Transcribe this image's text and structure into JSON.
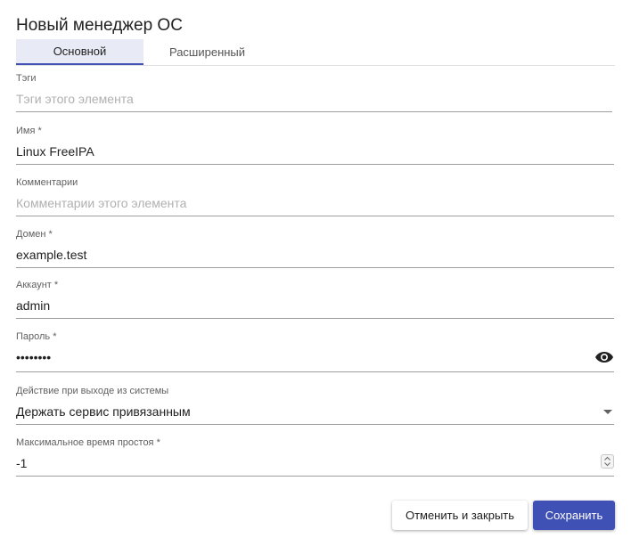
{
  "dialog": {
    "title": "Новый менеджер ОС"
  },
  "tabs": [
    {
      "label": "Основной",
      "active": true
    },
    {
      "label": "Расширенный",
      "active": false
    }
  ],
  "fields": {
    "tags": {
      "label": "Тэги",
      "value": "",
      "placeholder": "Тэги этого элемента"
    },
    "name": {
      "label": "Имя *",
      "value": "Linux FreeIPA"
    },
    "comments": {
      "label": "Комментарии",
      "value": "",
      "placeholder": "Комментарии этого элемента"
    },
    "domain": {
      "label": "Домен *",
      "value": "example.test"
    },
    "account": {
      "label": "Аккаунт *",
      "value": "admin"
    },
    "password": {
      "label": "Пароль *",
      "value": "password"
    },
    "logout_action": {
      "label": "Действие при выходе из системы",
      "value": "Держать сервис привязанным"
    },
    "max_idle": {
      "label": "Максимальное время простоя *",
      "value": "-1"
    }
  },
  "icons": {
    "password_toggle": "eye-icon",
    "select_caret": "caret-down-icon",
    "number_spinner": "spinner-icon"
  },
  "buttons": {
    "cancel": "Отменить и закрыть",
    "save": "Сохранить"
  },
  "colors": {
    "accent": "#3f51b5",
    "active_tab_bg": "#e8eaf6"
  }
}
